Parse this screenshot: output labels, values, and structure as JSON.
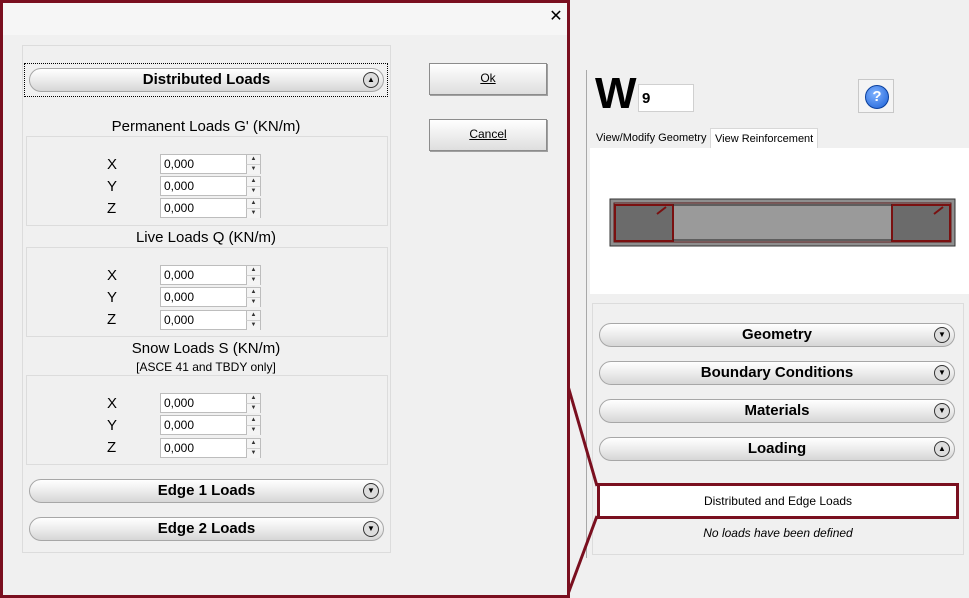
{
  "right": {
    "wall_letter": "W",
    "wall_id": "9",
    "help_glyph": "?",
    "tabs": [
      "View/Modify Geometry",
      "View Reinforcement"
    ],
    "accordions": [
      "Geometry",
      "Boundary Conditions",
      "Materials",
      "Loading"
    ],
    "dist_edge_label": "Distributed and Edge Loads",
    "no_loads_text": "No loads have been defined"
  },
  "dialog": {
    "close_glyph": "✕",
    "ok_label": "Ok",
    "cancel_label": "Cancel",
    "header": "Distributed Loads",
    "sections": [
      {
        "title": "Permanent Loads G' (KN/m)",
        "note": "",
        "rows": [
          {
            "axis": "X",
            "value": "0,000"
          },
          {
            "axis": "Y",
            "value": "0,000"
          },
          {
            "axis": "Z",
            "value": "0,000"
          }
        ]
      },
      {
        "title": "Live Loads Q (KN/m)",
        "note": "",
        "rows": [
          {
            "axis": "X",
            "value": "0,000"
          },
          {
            "axis": "Y",
            "value": "0,000"
          },
          {
            "axis": "Z",
            "value": "0,000"
          }
        ]
      },
      {
        "title": "Snow Loads S (KN/m)",
        "note": "[ASCE 41 and TBDY only]",
        "rows": [
          {
            "axis": "X",
            "value": "0,000"
          },
          {
            "axis": "Y",
            "value": "0,000"
          },
          {
            "axis": "Z",
            "value": "0,000"
          }
        ]
      }
    ],
    "edge1": "Edge 1 Loads",
    "edge2": "Edge 2 Loads"
  },
  "icons": {
    "chevron_down": "▼",
    "chevron_up": "▲",
    "spin_up": "▲",
    "spin_down": "▼"
  },
  "colors": {
    "highlight": "#7a0f1f"
  }
}
